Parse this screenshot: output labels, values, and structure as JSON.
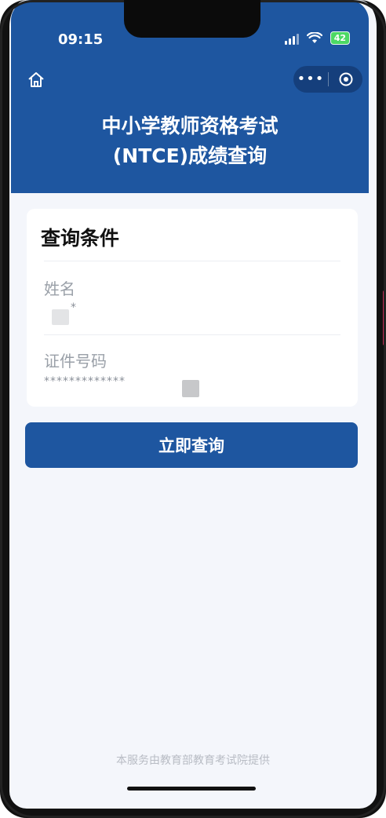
{
  "status_bar": {
    "time": "09:15",
    "battery": "42"
  },
  "nav": {
    "home_icon": "home-icon",
    "more_label": "•••",
    "close_icon": "target-circle-icon"
  },
  "header": {
    "title_line1": "中小学教师资格考试",
    "title_line2": "(NTCE)成绩查询"
  },
  "form": {
    "title": "查询条件",
    "name_label": "姓名",
    "name_value": "*",
    "id_label": "证件号码",
    "id_value": "*************"
  },
  "actions": {
    "submit_label": "立即查询"
  },
  "footer": {
    "text": "本服务由教育部教育考试院提供"
  },
  "colors": {
    "brand_blue": "#1e56a0",
    "background": "#f4f6fb"
  }
}
